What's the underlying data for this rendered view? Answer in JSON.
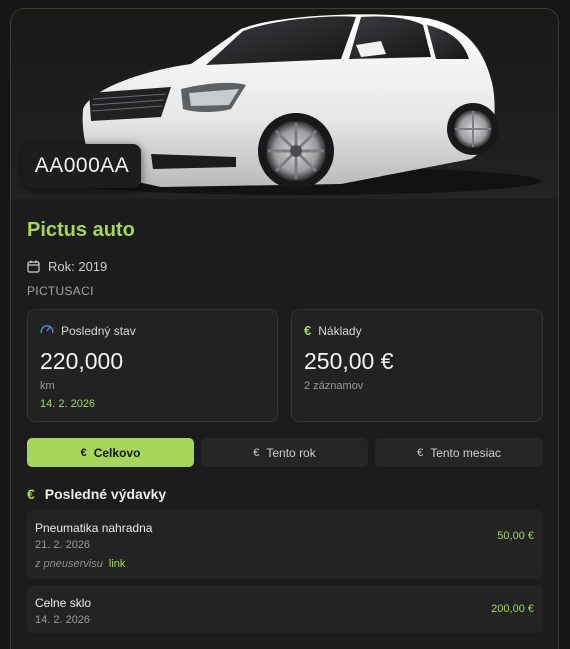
{
  "vehicle": {
    "plate": "AA000AA",
    "name": "Pictus auto",
    "year_label": "Rok: 2019",
    "vin": "PICTUSACI"
  },
  "stats": {
    "mileage": {
      "label": "Posledný stav",
      "value": "220,000",
      "unit": "km",
      "date": "14. 2. 2026"
    },
    "costs": {
      "label": "Náklady",
      "value": "250,00 €",
      "count": "2 záznamov"
    }
  },
  "tabs": [
    {
      "label": "Celkovo",
      "icon": "€",
      "active": true
    },
    {
      "label": "Tento rok",
      "icon": "€",
      "active": false
    },
    {
      "label": "Tento mesiac",
      "icon": "€",
      "active": false
    }
  ],
  "recent": {
    "title": "Posledné výdavky",
    "icon": "€",
    "items": [
      {
        "name": "Pneumatika nahradna",
        "date": "21. 2. 2026",
        "note": "z pneuservisu",
        "link": "link",
        "amount": "50,00 €"
      },
      {
        "name": "Celne sklo",
        "date": "14. 2. 2026",
        "amount": "200,00 €"
      }
    ]
  },
  "colors": {
    "accent": "#a6d65a",
    "background": "#141514",
    "card": "#1b1c1b",
    "gauge": "#4a90d9"
  }
}
